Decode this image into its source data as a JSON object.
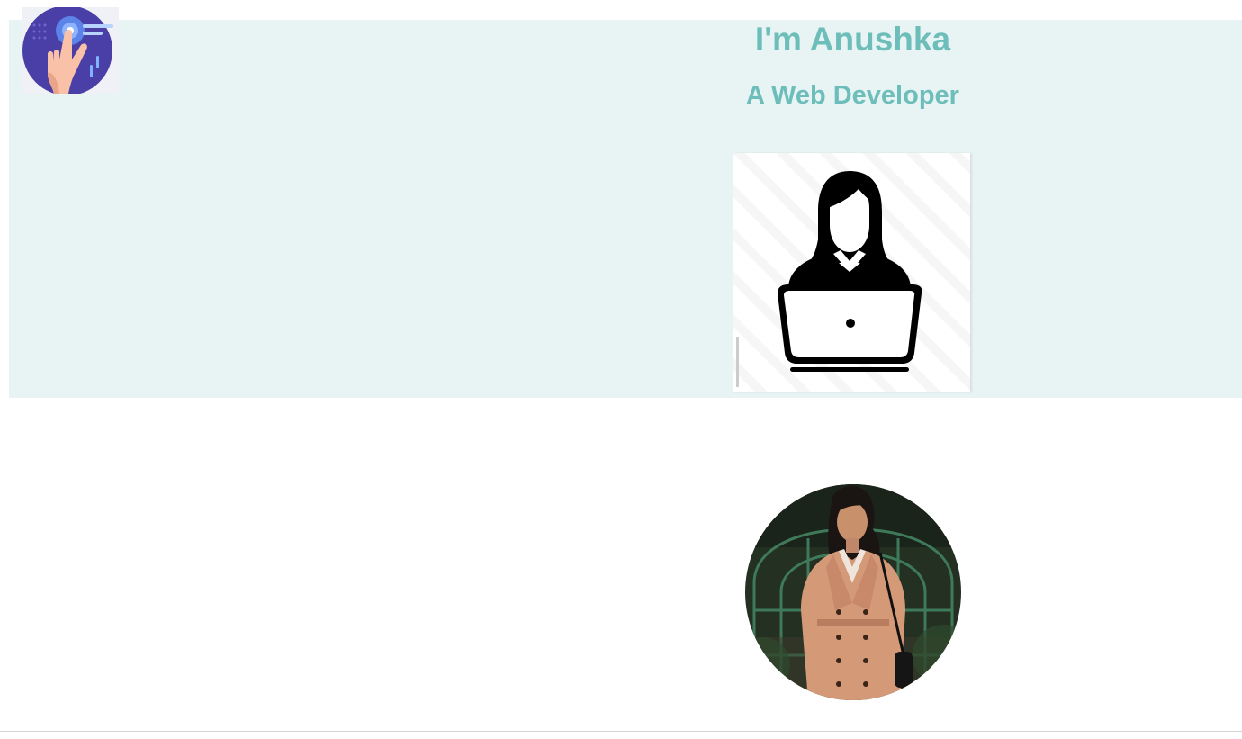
{
  "header": {
    "logo_icon": "touch-hand-icon",
    "title": "I'm Anushka",
    "subtitle": "A Web Developer"
  },
  "hero": {
    "background": "#e8f4f3",
    "accent_color": "#6dbebb",
    "illustration_icon": "woman-with-laptop-icon"
  },
  "about": {
    "photo_icon": "profile-photo"
  }
}
